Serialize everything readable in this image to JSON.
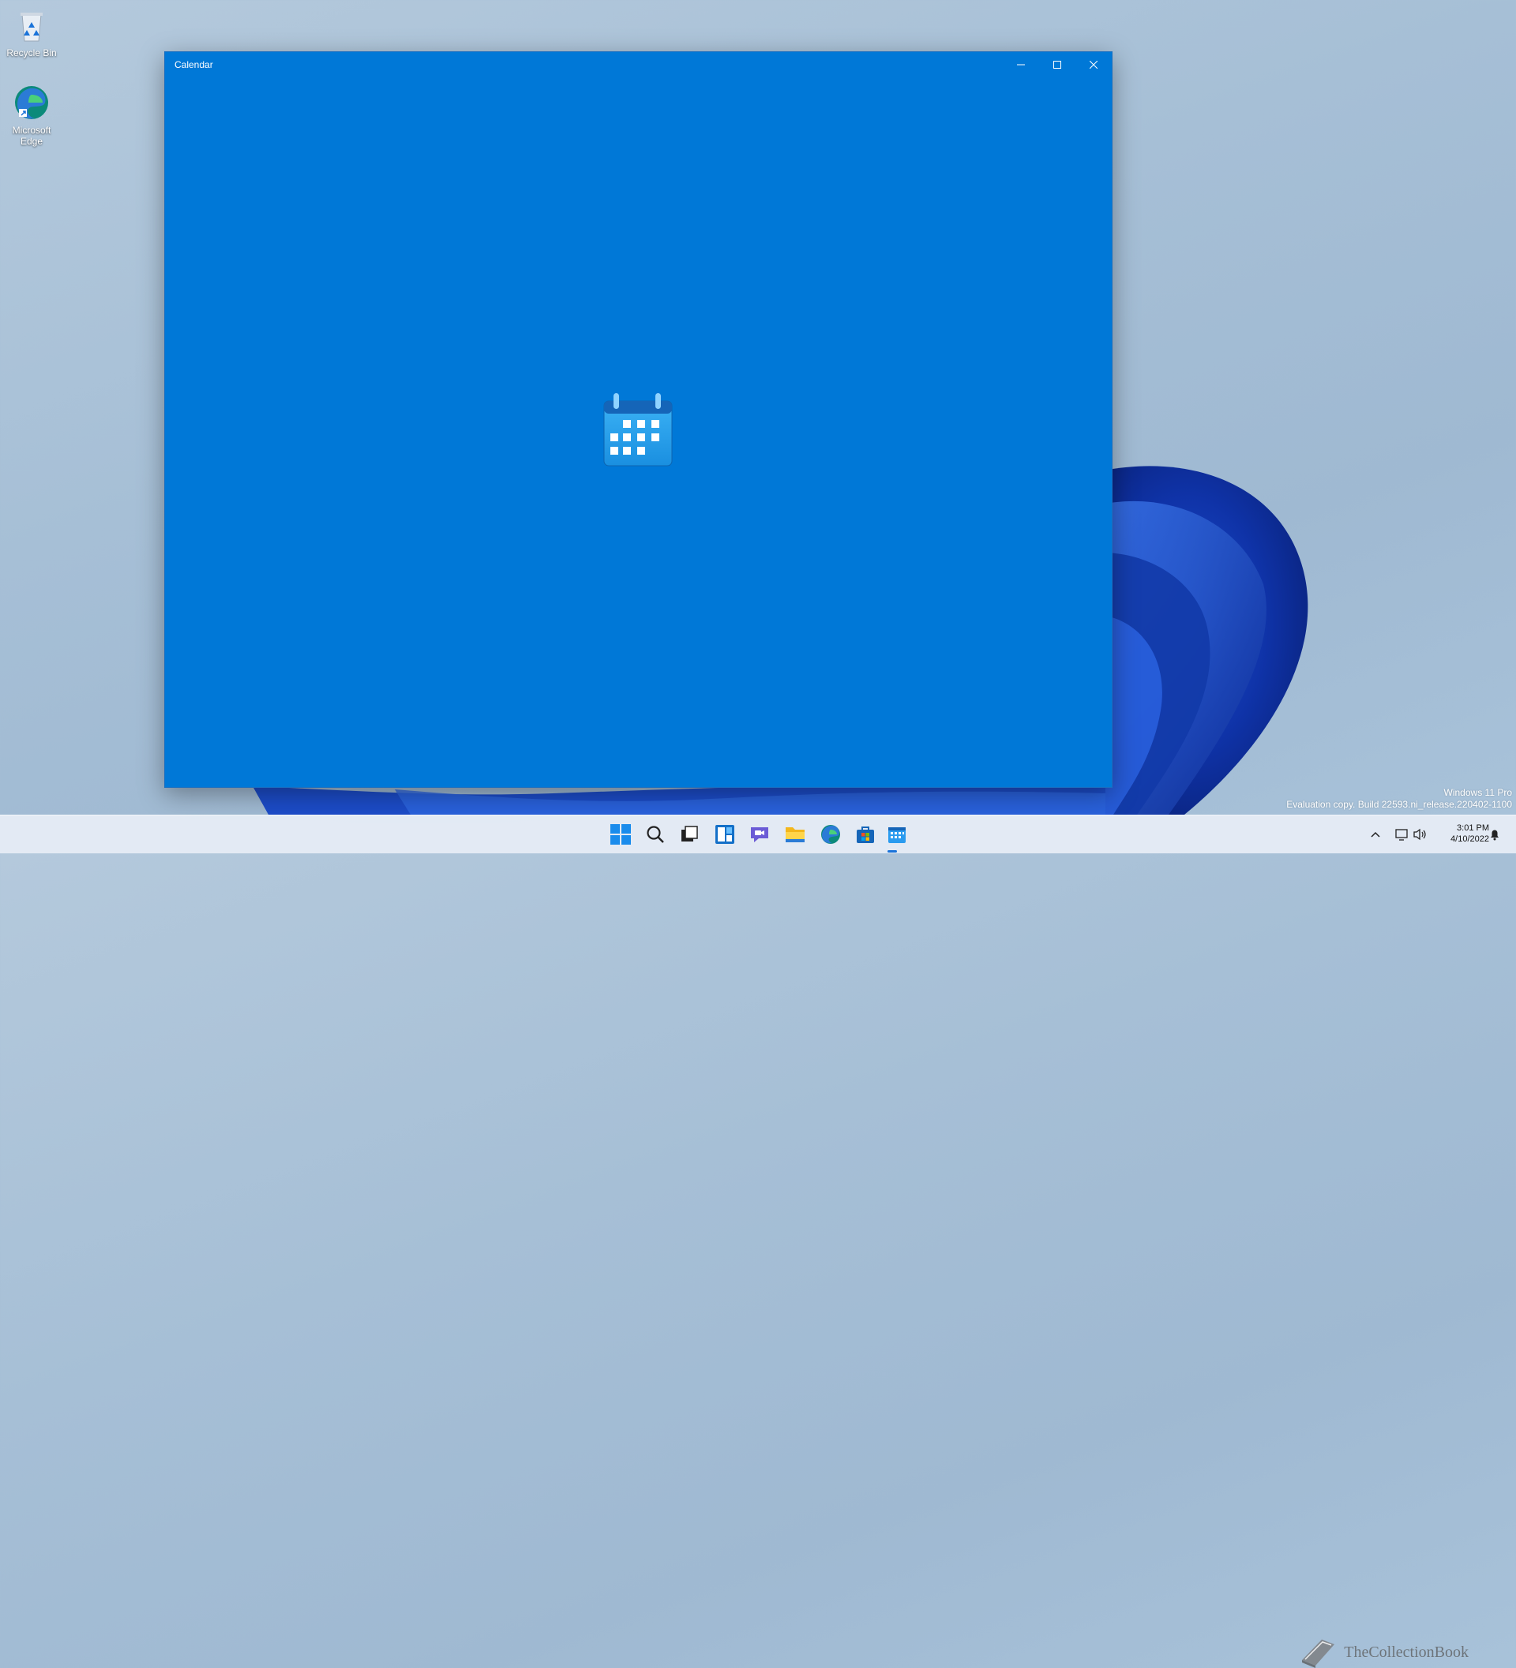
{
  "desktop": {
    "icons": [
      {
        "label": "Recycle Bin",
        "icon": "recycle-bin-icon"
      },
      {
        "label": "Microsoft Edge",
        "icon": "edge-icon"
      }
    ],
    "watermark": {
      "line1": "Windows 11 Pro",
      "line2": "Evaluation copy. Build 22593.ni_release.220402-1100"
    }
  },
  "window": {
    "title": "Calendar",
    "controls": [
      "minimize-icon",
      "maximize-icon",
      "close-icon"
    ],
    "accent_color": "#0078d7",
    "splash_icon": "calendar-icon"
  },
  "taskbar": {
    "apps": [
      "start-icon",
      "search-icon",
      "task-view-icon",
      "widgets-icon",
      "chat-icon",
      "file-explorer-icon",
      "edge-icon",
      "store-icon",
      "calendar-icon"
    ],
    "brand_watermark": "TheCollectionBook",
    "clock": {
      "time": "3:01 PM",
      "date": "4/10/2022"
    }
  }
}
